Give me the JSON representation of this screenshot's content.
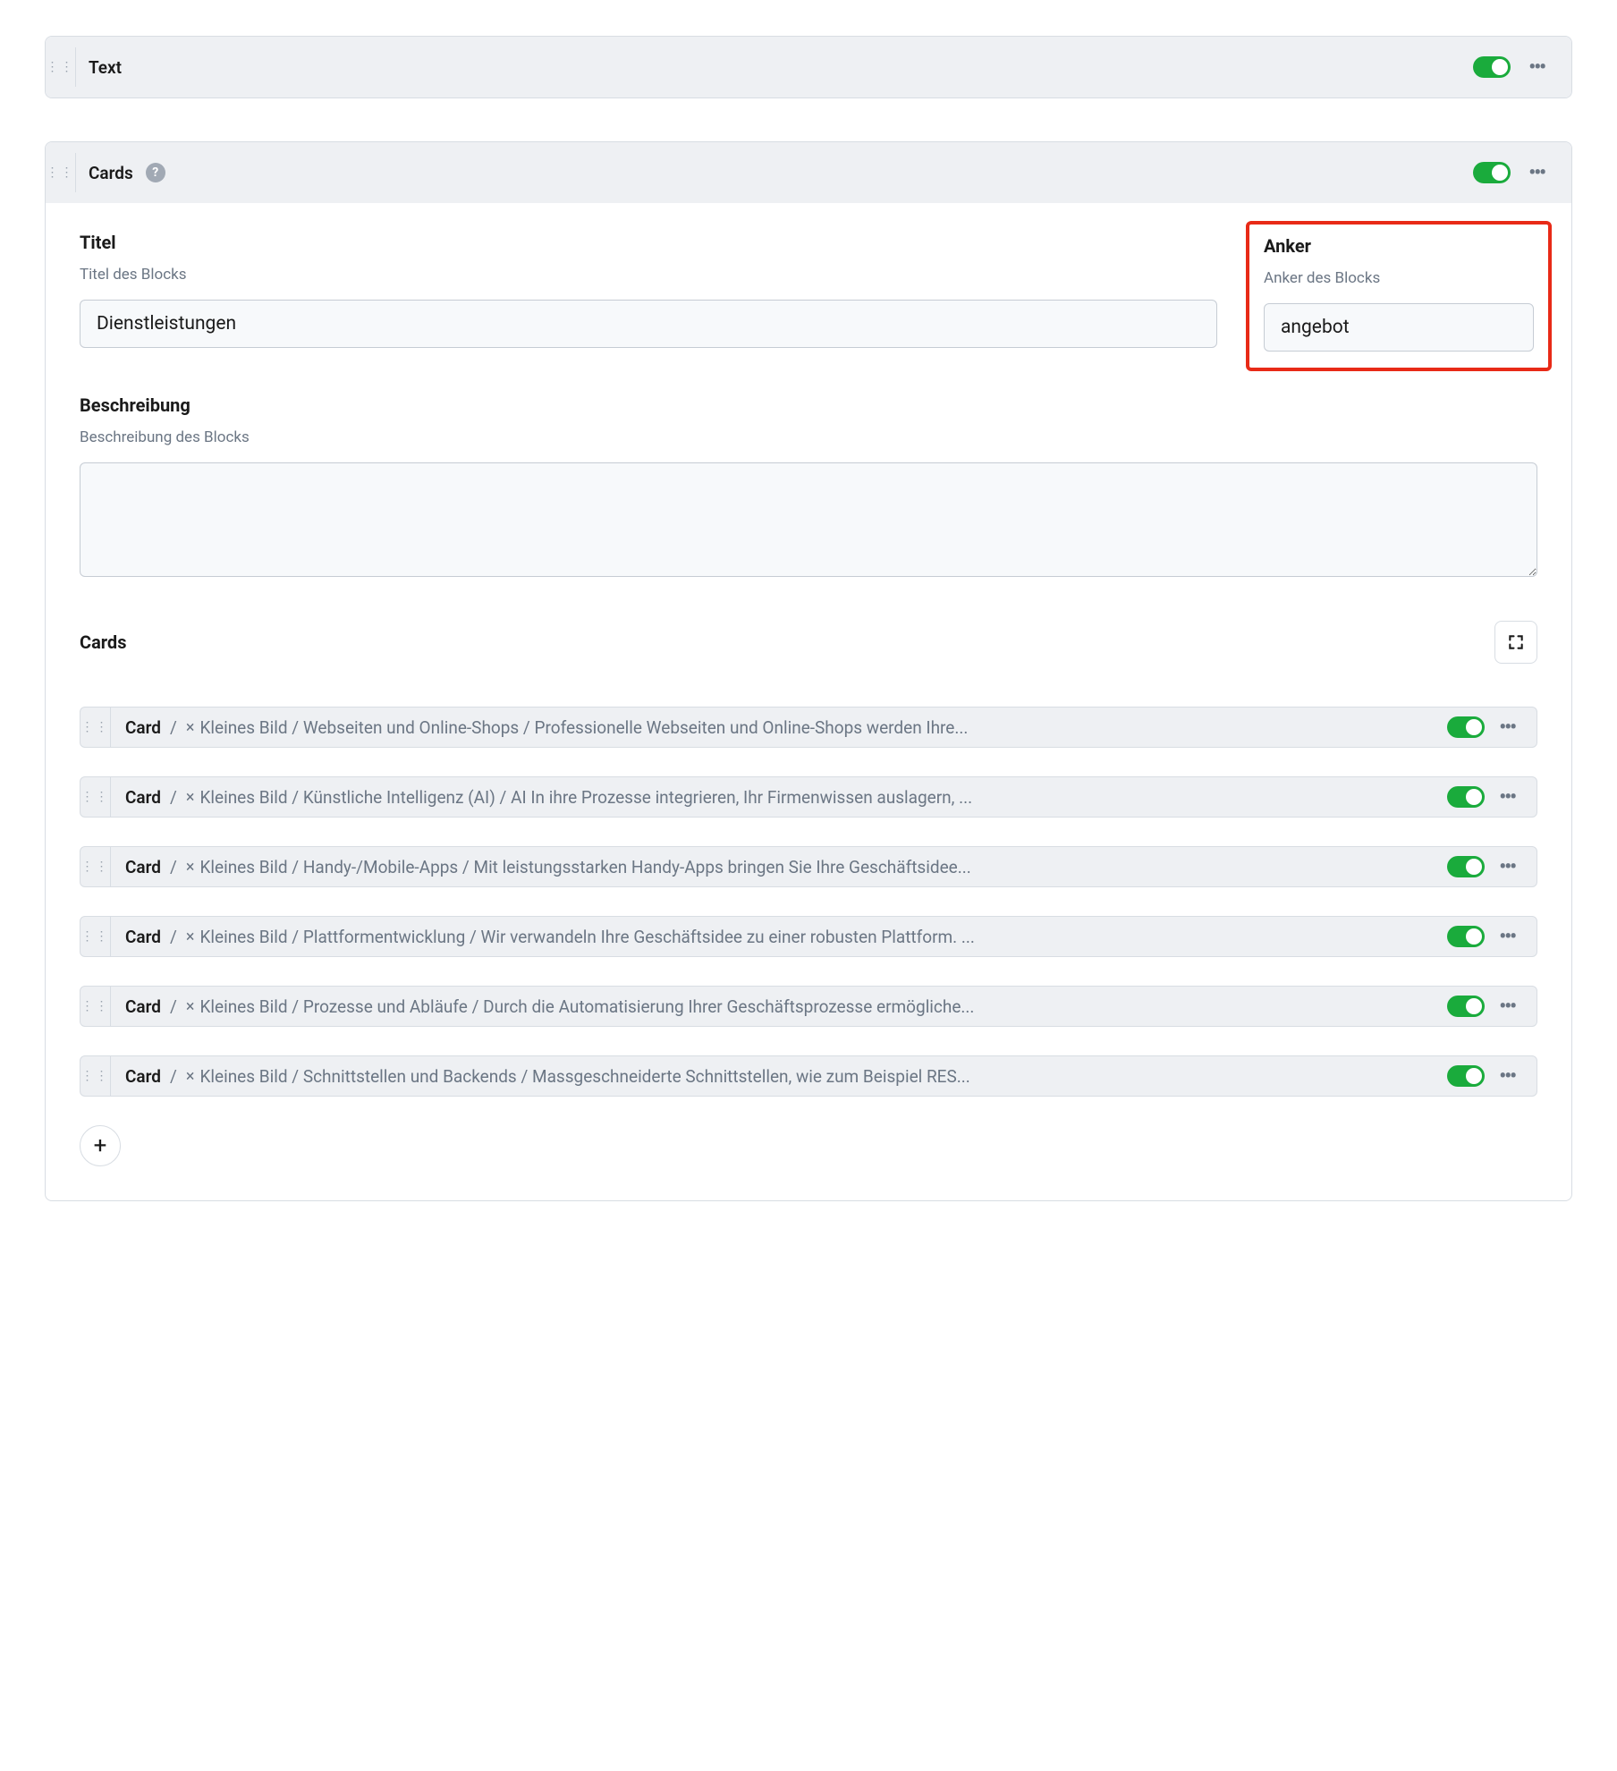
{
  "blocks": {
    "text": {
      "title": "Text"
    },
    "cards": {
      "title": "Cards",
      "fields": {
        "titel": {
          "label": "Titel",
          "sub": "Titel des Blocks",
          "value": "Dienstleistungen"
        },
        "anker": {
          "label": "Anker",
          "sub": "Anker des Blocks",
          "value": "angebot"
        },
        "beschreibung": {
          "label": "Beschreibung",
          "sub": "Beschreibung des Blocks",
          "value": ""
        }
      },
      "cards_section": {
        "title": "Cards",
        "item_label": "Card",
        "items": [
          {
            "desc": "Kleines Bild / Webseiten und Online-Shops / Professionelle Webseiten und Online-Shops werden Ihre..."
          },
          {
            "desc": "Kleines Bild / Künstliche Intelligenz (AI) / AI In ihre Prozesse integrieren, Ihr Firmenwissen auslagern, ..."
          },
          {
            "desc": "Kleines Bild / Handy-/Mobile-Apps / Mit leistungsstarken Handy-Apps bringen Sie Ihre Geschäftsidee..."
          },
          {
            "desc": "Kleines Bild / Plattformentwicklung / Wir verwandeln Ihre Geschäftsidee zu einer robusten Plattform. ..."
          },
          {
            "desc": "Kleines Bild / Prozesse und Abläufe / Durch die Automatisierung Ihrer Geschäftsprozesse ermögliche..."
          },
          {
            "desc": "Kleines Bild / Schnittstellen und Backends / Massgeschneiderte Schnittstellen, wie zum Beispiel RES..."
          }
        ]
      }
    }
  }
}
